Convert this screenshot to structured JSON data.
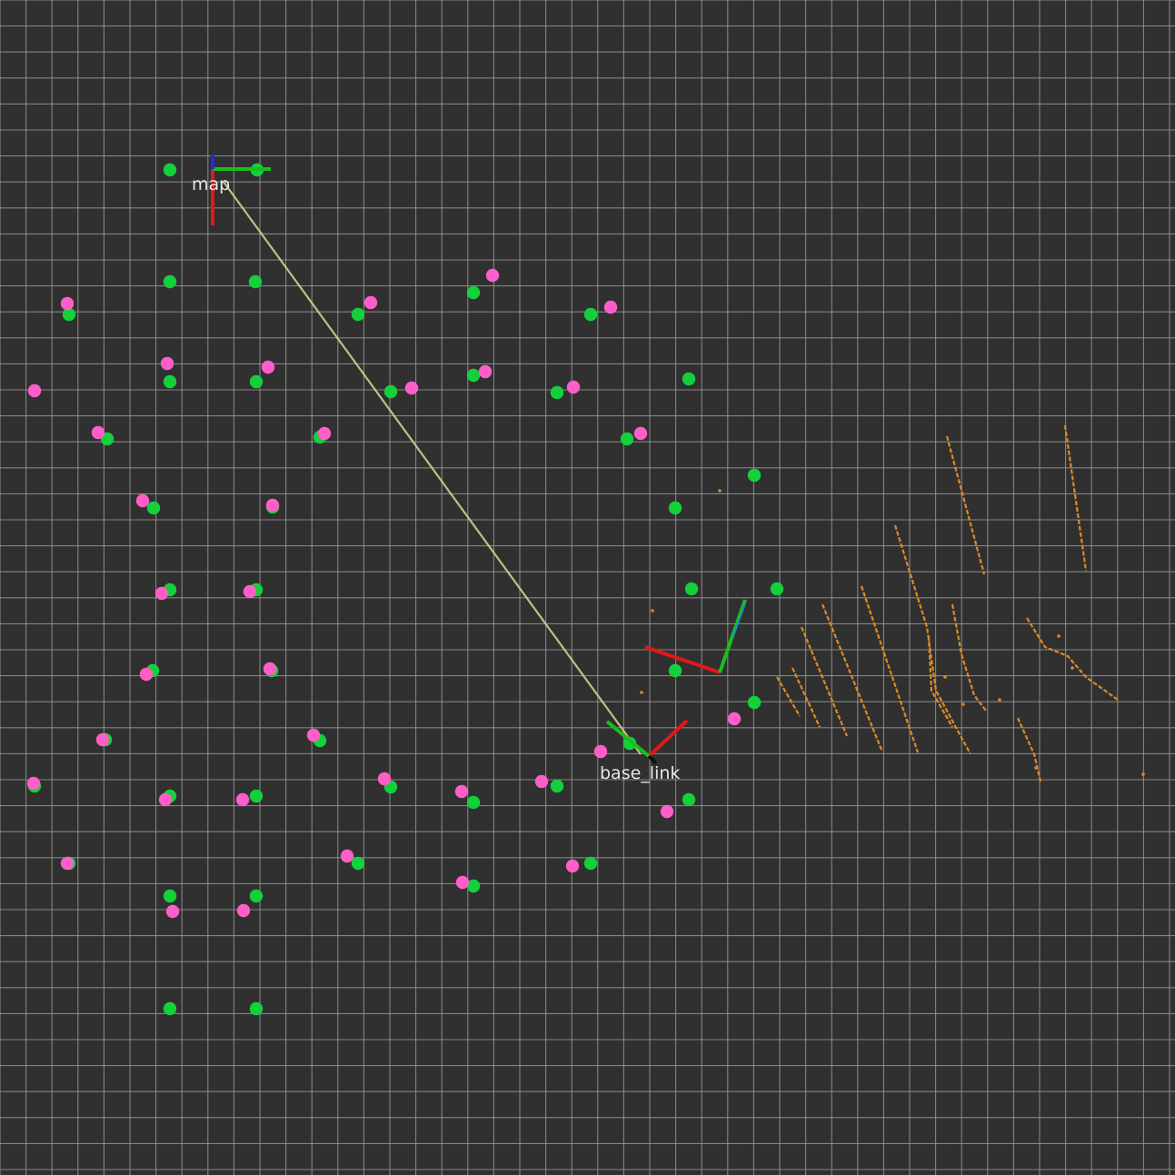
{
  "frames": [
    {
      "id": "map",
      "label": "map"
    },
    {
      "id": "base_link",
      "label": "base_link"
    }
  ],
  "marker_colors": {
    "background": "#303030",
    "grid": "#a0a0a0",
    "green_landmark": "#14d03a",
    "magenta_estimate": "#ff5ec8",
    "laser_scan": "#d98a2b",
    "tf_link": "#d8d890",
    "axis_x": "#e01818",
    "axis_y": "#18c018",
    "axis_z": "#1830e0"
  }
}
